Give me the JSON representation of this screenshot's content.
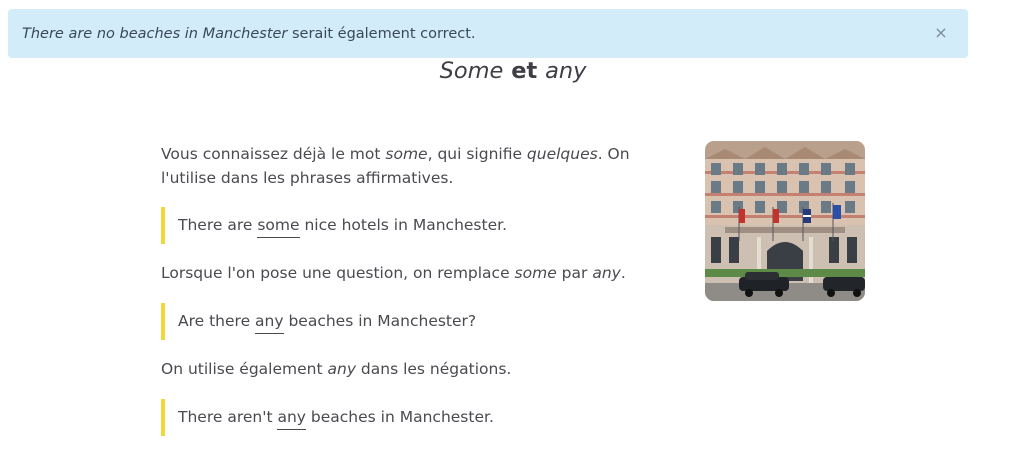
{
  "alert": {
    "sentence": "There are no beaches in Manchester",
    "rest": " serait également correct.",
    "close": "×"
  },
  "title": {
    "word1": "Some",
    "middle": " et ",
    "word2": "any"
  },
  "lesson": {
    "intro": {
      "t1": "Vous connaissez déjà le mot ",
      "e1": "some",
      "t2": ", qui signifie ",
      "e2": "quelques",
      "t3": ". On",
      "line2": "l'utilise dans les phrases affirmatives."
    },
    "example1": {
      "before": "There are ",
      "key": "some",
      "after": " nice hotels in Manchester."
    },
    "question_rule": {
      "t1": "Lorsque l'on pose une question, on remplace ",
      "e1": "some",
      "t2": " par ",
      "e2": "any",
      "t3": "."
    },
    "example2": {
      "before": "Are there ",
      "key": "any",
      "after": " beaches in Manchester?"
    },
    "negation_rule": {
      "t1": "On utilise également ",
      "e1": "any",
      "t2": " dans les négations."
    },
    "example3": {
      "before": "There aren't ",
      "key": "any",
      "after": " beaches in Manchester."
    }
  },
  "image": {
    "icon": "hotel-facade-photo"
  },
  "colors": {
    "alert_bg": "#d2ecf9",
    "quote_bar": "#f2d73a",
    "text": "#4a4a50"
  }
}
